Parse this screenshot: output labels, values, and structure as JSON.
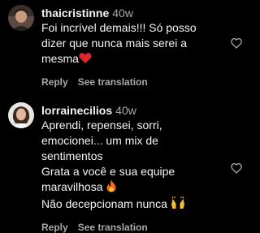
{
  "comments": [
    {
      "username": "thaicristinne",
      "time": "40w",
      "lines": [
        "Foi incrível demais!!! Só posso",
        "dizer que nunca mais serei a",
        "mesma"
      ],
      "reply_label": "Reply",
      "translate_label": "See translation",
      "icons": [
        "avatar",
        "red-heart-emoji",
        "like-heart-icon"
      ]
    },
    {
      "username": "lorrainecilios",
      "time": "40w",
      "lines": [
        "Aprendi, repensei, sorri,",
        "emocionei... um mix de",
        "sentimentos",
        "Grata a você e sua equipe",
        "maravilhosa",
        "Não decepcionam nunca"
      ],
      "reply_label": "Reply",
      "translate_label": "See translation",
      "icons": [
        "avatar",
        "fire-emoji",
        "raised-hands-emoji",
        "like-heart-icon"
      ]
    }
  ],
  "colors": {
    "background": "#000000",
    "text": "#f5f5f5",
    "secondary": "#a8a8a8",
    "heart_emoji": "#e0262d",
    "fire_emoji": "#f5671b"
  }
}
